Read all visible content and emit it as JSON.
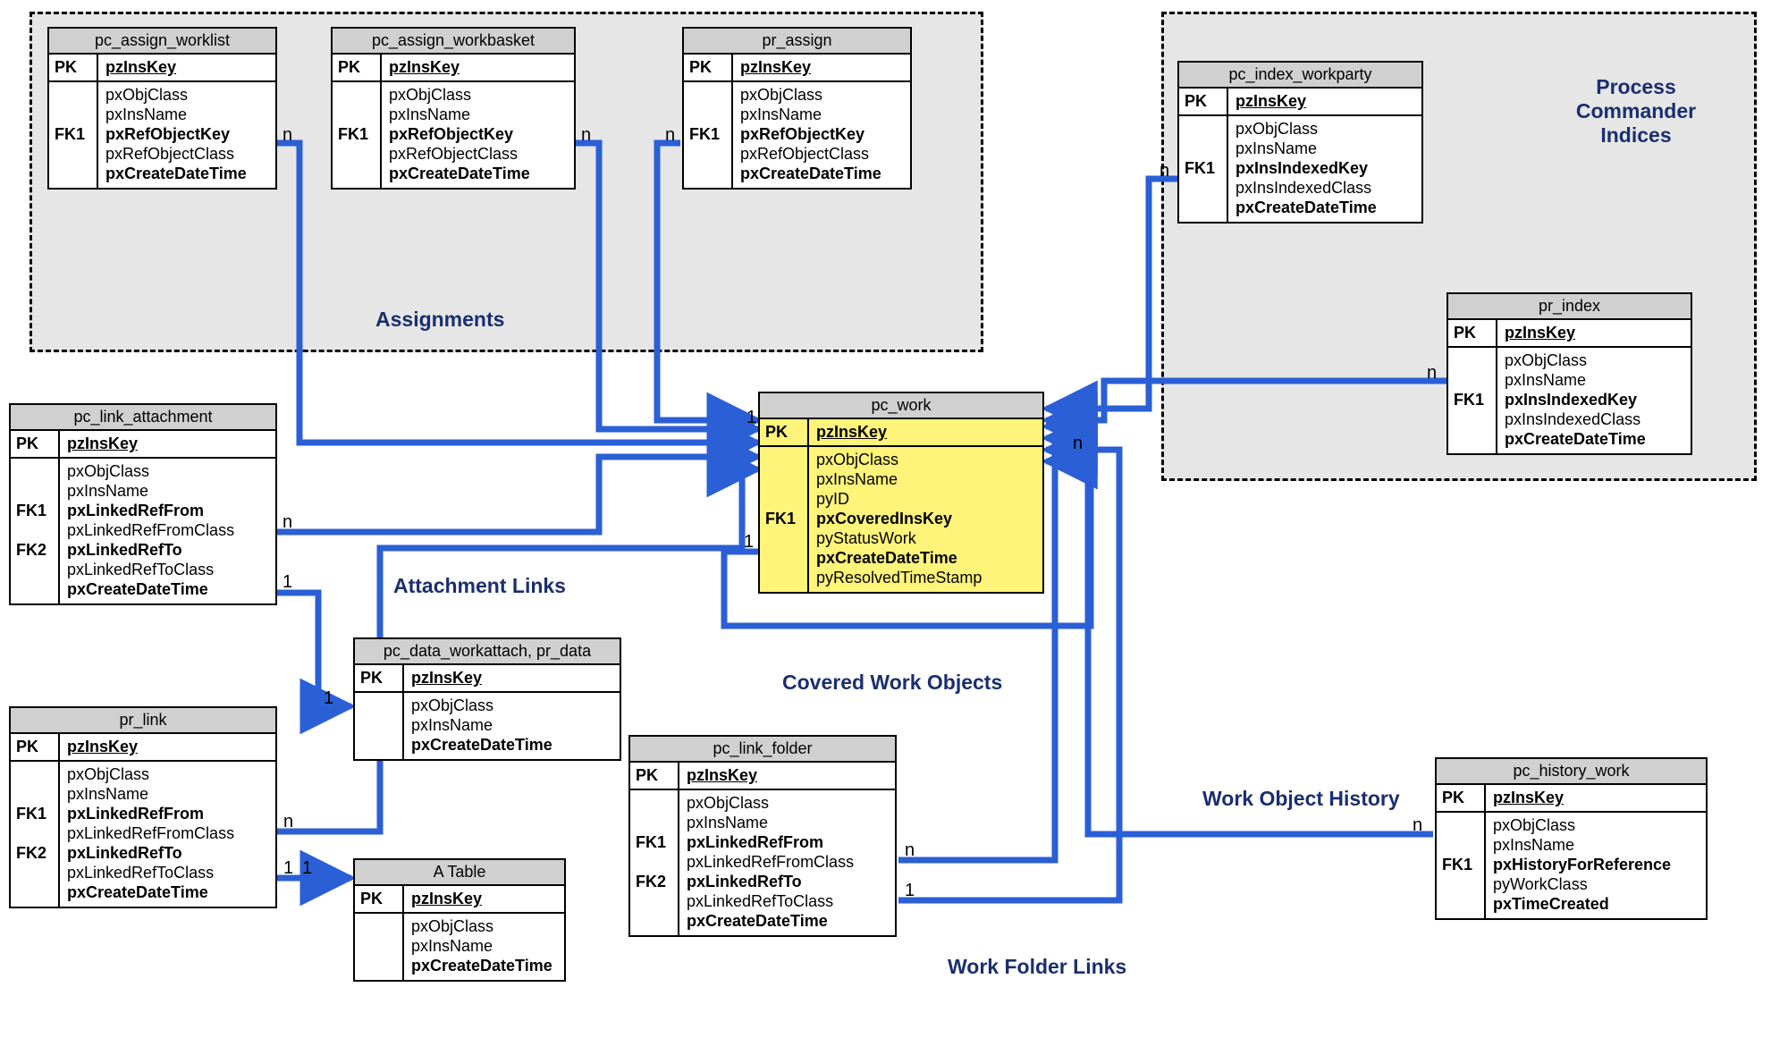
{
  "sections": {
    "assignments": "Assignments",
    "indices": "Process Commander Indices",
    "attachment_links": "Attachment Links",
    "covered": "Covered Work Objects",
    "history": "Work Object History",
    "folder_links": "Work Folder Links"
  },
  "entities": {
    "worklist": {
      "title": "pc_assign_worklist",
      "pk": "pzInsKey",
      "keys": [
        "",
        "",
        "FK1",
        "",
        ""
      ],
      "fields": [
        "pxObjClass",
        "pxInsName",
        "pxRefObjectKey",
        "pxRefObjectClass",
        "pxCreateDateTime"
      ],
      "bold": [
        false,
        false,
        true,
        false,
        true
      ]
    },
    "workbasket": {
      "title": "pc_assign_workbasket",
      "pk": "pzInsKey",
      "keys": [
        "",
        "",
        "FK1",
        "",
        ""
      ],
      "fields": [
        "pxObjClass",
        "pxInsName",
        "pxRefObjectKey",
        "pxRefObjectClass",
        "pxCreateDateTime"
      ],
      "bold": [
        false,
        false,
        true,
        false,
        true
      ]
    },
    "prassign": {
      "title": "pr_assign",
      "pk": "pzInsKey",
      "keys": [
        "",
        "",
        "FK1",
        "",
        ""
      ],
      "fields": [
        "pxObjClass",
        "pxInsName",
        "pxRefObjectKey",
        "pxRefObjectClass",
        "pxCreateDateTime"
      ],
      "bold": [
        false,
        false,
        true,
        false,
        true
      ]
    },
    "linkattach": {
      "title": "pc_link_attachment",
      "pk": "pzInsKey",
      "keys": [
        "",
        "",
        "FK1",
        "",
        "FK2",
        "",
        ""
      ],
      "fields": [
        "pxObjClass",
        "pxInsName",
        "pxLinkedRefFrom",
        "pxLinkedRefFromClass",
        "pxLinkedRefTo",
        "pxLinkedRefToClass",
        "pxCreateDateTime"
      ],
      "bold": [
        false,
        false,
        true,
        false,
        true,
        false,
        true
      ]
    },
    "prlink": {
      "title": "pr_link",
      "pk": "pzInsKey",
      "keys": [
        "",
        "",
        "FK1",
        "",
        "FK2",
        "",
        ""
      ],
      "fields": [
        "pxObjClass",
        "pxInsName",
        "pxLinkedRefFrom",
        "pxLinkedRefFromClass",
        "pxLinkedRefTo",
        "pxLinkedRefToClass",
        "pxCreateDateTime"
      ],
      "bold": [
        false,
        false,
        true,
        false,
        true,
        false,
        true
      ]
    },
    "workattach": {
      "title": "pc_data_workattach, pr_data",
      "pk": "pzInsKey",
      "keys": [
        "",
        "",
        ""
      ],
      "fields": [
        "pxObjClass",
        "pxInsName",
        "pxCreateDateTime"
      ],
      "bold": [
        false,
        false,
        true
      ]
    },
    "atable": {
      "title": "A Table",
      "pk": "pzInsKey",
      "keys": [
        "",
        "",
        ""
      ],
      "fields": [
        "pxObjClass",
        "pxInsName",
        "pxCreateDateTime"
      ],
      "bold": [
        false,
        false,
        true
      ]
    },
    "work": {
      "title": "pc_work",
      "pk": "pzInsKey",
      "keys": [
        "",
        "",
        "",
        "FK1",
        "",
        "",
        ""
      ],
      "fields": [
        "pxObjClass",
        "pxInsName",
        "pyID",
        "pxCoveredInsKey",
        "pyStatusWork",
        "pxCreateDateTime",
        "pyResolvedTimeStamp"
      ],
      "bold": [
        false,
        false,
        false,
        true,
        false,
        true,
        false
      ]
    },
    "linkfolder": {
      "title": "pc_link_folder",
      "pk": "pzInsKey",
      "keys": [
        "",
        "",
        "FK1",
        "",
        "FK2",
        "",
        ""
      ],
      "fields": [
        "pxObjClass",
        "pxInsName",
        "pxLinkedRefFrom",
        "pxLinkedRefFromClass",
        "pxLinkedRefTo",
        "pxLinkedRefToClass",
        "pxCreateDateTime"
      ],
      "bold": [
        false,
        false,
        true,
        false,
        true,
        false,
        true
      ]
    },
    "workparty": {
      "title": "pc_index_workparty",
      "pk": "pzInsKey",
      "keys": [
        "",
        "",
        "FK1",
        "",
        ""
      ],
      "fields": [
        "pxObjClass",
        "pxInsName",
        "pxInsIndexedKey",
        "pxInsIndexedClass",
        "pxCreateDateTime"
      ],
      "bold": [
        false,
        false,
        true,
        false,
        true
      ]
    },
    "prindex": {
      "title": "pr_index",
      "pk": "pzInsKey",
      "keys": [
        "",
        "",
        "FK1",
        "",
        ""
      ],
      "fields": [
        "pxObjClass",
        "pxInsName",
        "pxInsIndexedKey",
        "pxInsIndexedClass",
        "pxCreateDateTime"
      ],
      "bold": [
        false,
        false,
        true,
        false,
        true
      ]
    },
    "history": {
      "title": "pc_history_work",
      "pk": "pzInsKey",
      "keys": [
        "",
        "",
        "FK1",
        "",
        ""
      ],
      "fields": [
        "pxObjClass",
        "pxInsName",
        "pxHistoryForReference",
        "pyWorkClass",
        "pxTimeCreated"
      ],
      "bold": [
        false,
        false,
        true,
        false,
        true
      ]
    }
  },
  "cardinalities": {
    "worklist_n": "n",
    "workbasket_n": "n",
    "prassign_n": "n",
    "linkattach_n": "n",
    "linkattach_1": "1",
    "prlink_n": "n",
    "prlink_1a": "1",
    "prlink_1b": "1",
    "workattach_1": "1",
    "work_1a": "1",
    "work_1b": "1",
    "work_n": "n",
    "workparty_n": "n",
    "prindex_n": "n",
    "history_n": "n",
    "folder_n": "n",
    "folder_1": "1"
  }
}
